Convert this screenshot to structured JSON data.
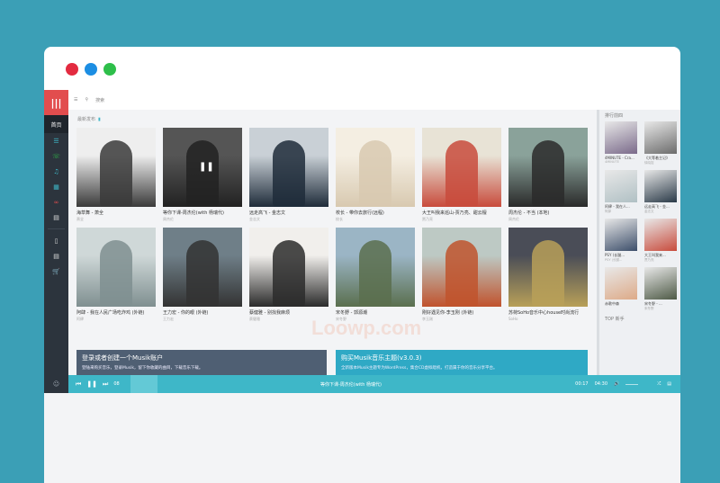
{
  "colors": {
    "background": "#3b9fb6",
    "accent": "#e24d4e",
    "player": "#3eb7c8",
    "rail": "#2c343d"
  },
  "window_dots": [
    {
      "color": "#e32b40",
      "name": "close"
    },
    {
      "color": "#1c8ee3",
      "name": "minimize"
    },
    {
      "color": "#2ebf4a",
      "name": "maximize"
    }
  ],
  "rail": {
    "logo_icon": "equalizer-icon",
    "active": "首页"
  },
  "topbar": {
    "menu_icon": "list-icon",
    "search_placeholder": "搜索"
  },
  "main": {
    "section_title": "最新发布",
    "cards": [
      {
        "title": "海草舞 - 萧全",
        "artist": "萧全",
        "img": "#3a3a3a",
        "bg": "#eee"
      },
      {
        "title": "等你下课-周杰伦(with 杨瑞代)",
        "artist": "周杰伦",
        "img": "#222",
        "bg": "#555"
      },
      {
        "title": "远走高飞 - 金志文",
        "artist": "金志文",
        "img": "#1f2c3a",
        "bg": "#c9d0d6"
      },
      {
        "title": "校长 - 带你去旅行(远程)",
        "artist": "校长",
        "img": "#d8c9b0",
        "bg": "#f4eee2"
      },
      {
        "title": "大王叫我来巡山-贾乃亮、甜云檀",
        "artist": "贾乃亮",
        "img": "#c84b3c",
        "bg": "#e8e3d6"
      },
      {
        "title": "周杰伦 - 不当 (本地)",
        "artist": "周杰伦",
        "img": "#2a2a2a",
        "bg": "#8aa29a"
      },
      {
        "title": "阿肆 - 我在人民广场吃炸鸡 (外链)",
        "artist": "阿肆",
        "img": "#7f8f90",
        "bg": "#cfd8d8"
      },
      {
        "title": "王力宏 - 你的眼 (外链)",
        "artist": "王力宏",
        "img": "#333",
        "bg": "#6f7f88"
      },
      {
        "title": "蔡健雅 - 别找我麻烦",
        "artist": "蔡健雅",
        "img": "#2b2b2b",
        "bg": "#f1efec"
      },
      {
        "title": "宋冬野 - 郭源潮",
        "artist": "宋冬野",
        "img": "#5a6f4e",
        "bg": "#9bb5c5"
      },
      {
        "title": "刚好遇见你-李玉刚 (外链)",
        "artist": "李玉刚",
        "img": "#c0532d",
        "bg": "#bdc9c4"
      },
      {
        "title": "苏荷SoHo音乐中心house时尚流行",
        "artist": "SoHo",
        "img": "#b8a058",
        "bg": "#4a4d57"
      }
    ],
    "banner_left": {
      "title": "登录或者创建一个Musik账户",
      "text": "登陆来购买音乐，登录Musik，留下你收藏的曲目，下载音乐下载。",
      "bg": "#4f5f73"
    },
    "banner_right": {
      "title": "购买Musik音乐主题(v3.0.3)",
      "text": "全新版本Musik主题专为WordPress，集合CD虚拟唱机，打造属于你的音乐分享平台。",
      "bg": "#2fa9c5"
    }
  },
  "rpanel": {
    "heading": "排行前四",
    "items": [
      {
        "title": "4MINUTE - Cra...",
        "artist": "4MINUTE",
        "img": "#7a6a8a"
      },
      {
        "title": "《大等着主记》",
        "artist": "徐晓捉",
        "img": "#6c6c6c"
      },
      {
        "title": "阿肆 - 我在人...",
        "artist": "阿肆",
        "img": "#b0c0c4"
      },
      {
        "title": "远走高飞 - 金...",
        "artist": "金志文",
        "img": "#2a3a48"
      },
      {
        "title": "PSY (长腿...",
        "artist": "PSY (长腿...",
        "img": "#3c4e6a"
      },
      {
        "title": "大王叫我来...",
        "artist": "贾乃亮",
        "img": "#c84b3c"
      },
      {
        "title": "赤歌中森",
        "artist": "",
        "img": "#ddaa88"
      },
      {
        "title": "宋冬野 - ...",
        "artist": "宋冬野",
        "img": "#4e5a46"
      }
    ],
    "top_label": "TOP 新手"
  },
  "player": {
    "prev_icon": "prev-icon",
    "pause_icon": "pause-icon",
    "next_icon": "next-icon",
    "mode": "08",
    "now_playing": "等你下课-周杰伦(with 杨瑞代)",
    "time_current": "00:17",
    "time_total": "04:30"
  },
  "watermark": "Loowp.com"
}
